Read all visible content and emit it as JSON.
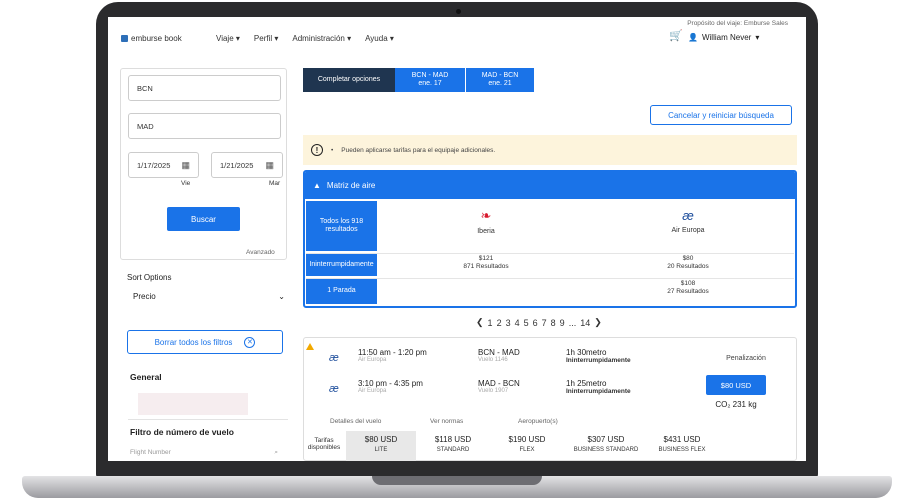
{
  "app": {
    "logo_text": "emburse book"
  },
  "nav": [
    "Viaje",
    "Perfil",
    "Administración",
    "Ayuda"
  ],
  "header": {
    "trip_purpose": "Propósito del viaje: Emburse Sales",
    "user_name": "William Never"
  },
  "search": {
    "origin": "BCN",
    "destination": "MAD",
    "depart_date": "1/17/2025",
    "return_date": "1/21/2025",
    "depart_day": "Vie",
    "return_day": "Mar",
    "search_button": "Buscar",
    "advanced_link": "Avanzado"
  },
  "sort": {
    "label": "Sort Options",
    "selected": "Precio"
  },
  "filters": {
    "clear_button": "Borrar todos los filtros",
    "general_title": "General",
    "flight_number_title": "Filtro de número de vuelo",
    "flight_number_placeholder": "Flight Number"
  },
  "tabs": {
    "complete": "Completar opciones",
    "leg1_route": "BCN - MAD",
    "leg1_date": "ene. 17",
    "leg2_route": "MAD - BCN",
    "leg2_date": "ene. 21"
  },
  "cancel_button": "Cancelar y reiniciar búsqueda",
  "alert": {
    "text": "Pueden aplicarse tarifas para el equipaje adicionales."
  },
  "matrix": {
    "title": "Matriz de aire",
    "all_results": "Todos los 918 resultados",
    "rows": [
      "Ininterrumpidamente",
      "1 Parada"
    ],
    "airlines": [
      {
        "name": "Iberia",
        "nonstop_price": "$121",
        "nonstop_results": "871 Resultados",
        "onestop_price": "",
        "onestop_results": ""
      },
      {
        "name": "Air Europa",
        "nonstop_price": "$80",
        "nonstop_results": "20 Resultados",
        "onestop_price": "$108",
        "onestop_results": "27 Resultados"
      }
    ]
  },
  "pagination": {
    "pages": [
      "1",
      "2",
      "3",
      "4",
      "5",
      "6",
      "7",
      "8",
      "9"
    ],
    "ellipsis": "...",
    "last": "14"
  },
  "flight": {
    "segments": [
      {
        "time": "11:50 am - 1:20 pm",
        "airline": "Air Europa",
        "route": "BCN - MAD",
        "flight_no": "Vuelo 1146",
        "duration": "1h 30metro",
        "stops": "Ininterrumpidamente"
      },
      {
        "time": "3:10 pm - 4:35 pm",
        "airline": "Air Europa",
        "route": "MAD - BCN",
        "flight_no": "Vuelo 1907",
        "duration": "1h 25metro",
        "stops": "Ininterrumpidamente"
      }
    ],
    "penalty_label": "Penalización",
    "price_button": "$80 USD",
    "co2": "CO₂ 231 kg",
    "links": [
      "Detalles del vuelo",
      "Ver normas",
      "Aeropuerto(s)"
    ],
    "fares_label": "Tarifas disponibles",
    "fares": [
      {
        "price": "$80 USD",
        "name": "LITE"
      },
      {
        "price": "$118 USD",
        "name": "STANDARD"
      },
      {
        "price": "$190 USD",
        "name": "FLEX"
      },
      {
        "price": "$307 USD",
        "name": "BUSINESS STANDARD"
      },
      {
        "price": "$431 USD",
        "name": "BUSINESS FLEX"
      }
    ]
  },
  "colors": {
    "primary": "#1a73e8",
    "dark_tab": "#1f3550",
    "alert_bg": "#fdf4dc",
    "iberia": "#d7192d",
    "air_europa": "#1e4e9c"
  }
}
